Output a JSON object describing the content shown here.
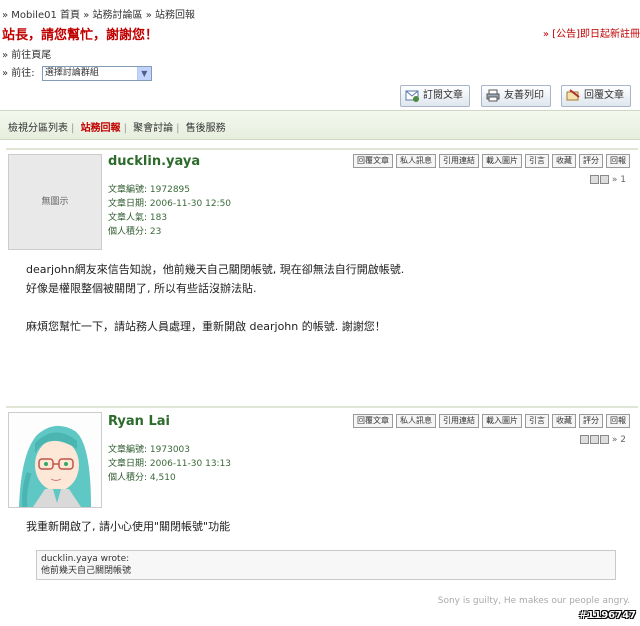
{
  "breadcrumb": [
    "» Mobile01 首頁",
    "» 站務討論區",
    "» 站務回報"
  ],
  "headline": "站長，請您幫忙，謝謝您！",
  "announcement": "» [公告]即日起新註冊",
  "latest_link": "» 前往頁尾",
  "goto": {
    "label": "» 前往:",
    "select_value": "選擇討論群組"
  },
  "top_buttons": {
    "subscribe": "訂閱文章",
    "print": "友善列印",
    "reply": "回覆文章"
  },
  "tabs": [
    "檢視分區列表",
    "站務回報",
    "聚會討論",
    "售後服務"
  ],
  "post_buttons": [
    "回覆文章",
    "私人訊息",
    "引用連結",
    "載入圖片",
    "引言",
    "收藏",
    "評分",
    "回報"
  ],
  "posts": [
    {
      "username": "ducklin.yaya",
      "avatar_text": "無圖示",
      "meta": [
        {
          "k": "文章編號:",
          "v": "1972895"
        },
        {
          "k": "文章日期:",
          "v": "2006-11-30 12:50"
        },
        {
          "k": "文章人氣:",
          "v": "183"
        },
        {
          "k": "個人積分:",
          "v": "23"
        }
      ],
      "floor": "» 1",
      "body": [
        "dearjohn網友來信告知說，他前幾天自己關閉帳號, 現在卻無法自行開啟帳號.",
        "好像是權限整個被關閉了, 所以有些話沒辦法貼.",
        "",
        "麻煩您幫忙一下，請站務人員處理，重新開啟 dearjohn 的帳號. 謝謝您！"
      ]
    },
    {
      "username": "Ryan Lai",
      "meta": [
        {
          "k": "文章編號:",
          "v": "1973003"
        },
        {
          "k": "文章日期:",
          "v": "2006-11-30 13:13"
        },
        {
          "k": "個人積分:",
          "v": "4,510"
        }
      ],
      "floor": "» 2",
      "body": [
        "我重新開啟了, 請小心使用\"關閉帳號\"功能"
      ],
      "quote_author": "ducklin.yaya wrote:",
      "quote_text": "他前幾天自己關閉帳號",
      "signature": "Sony is guilty, He makes our people angry."
    }
  ],
  "watermark": "#1196747"
}
